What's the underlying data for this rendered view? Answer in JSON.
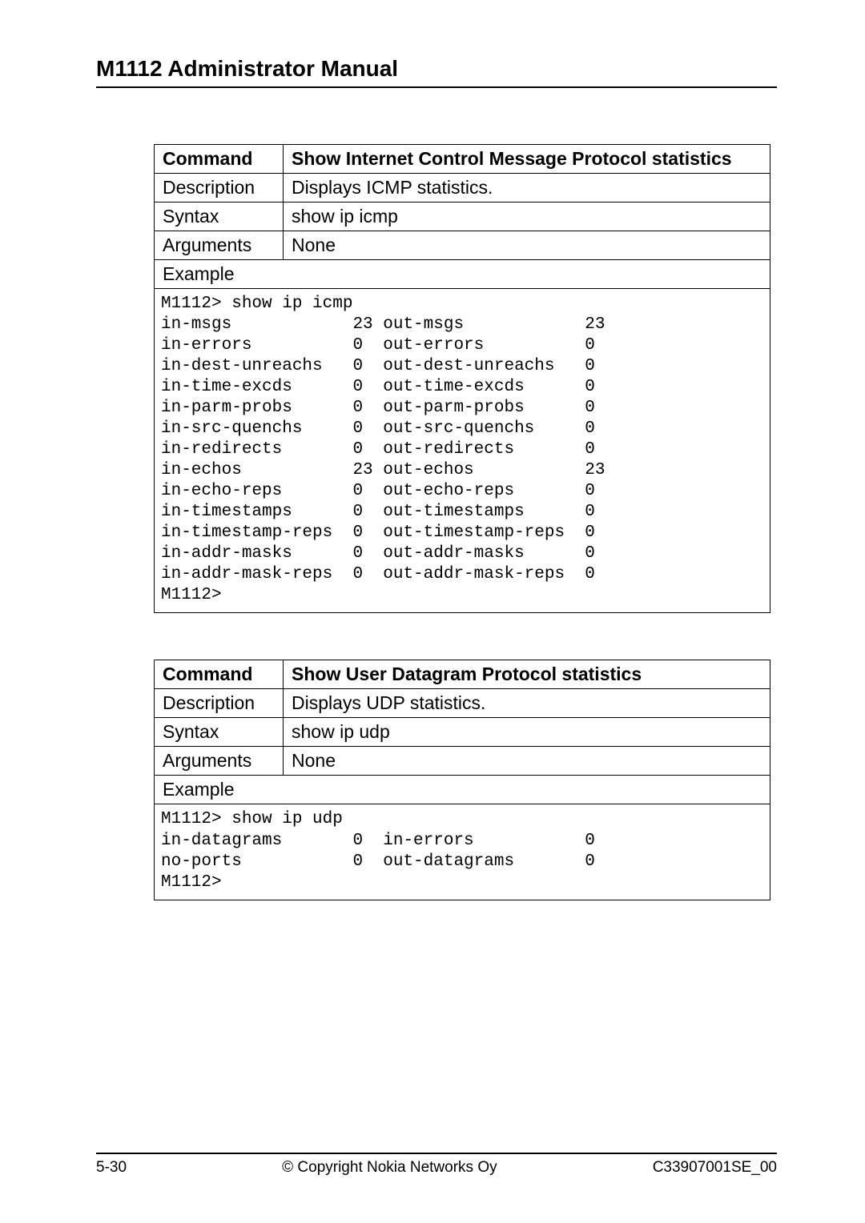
{
  "header": {
    "title": "M1112 Administrator Manual"
  },
  "table1": {
    "command_label": "Command",
    "command_value": "Show Internet Control Message Protocol statistics",
    "description_label": "Description",
    "description_value": "Displays ICMP statistics.",
    "syntax_label": "Syntax",
    "syntax_value": "show ip icmp",
    "arguments_label": "Arguments",
    "arguments_value": "None",
    "example_label": "Example",
    "example_code": "M1112> show ip icmp\nin-msgs            23 out-msgs            23\nin-errors          0  out-errors          0\nin-dest-unreachs   0  out-dest-unreachs   0\nin-time-excds      0  out-time-excds      0\nin-parm-probs      0  out-parm-probs      0\nin-src-quenchs     0  out-src-quenchs     0\nin-redirects       0  out-redirects       0\nin-echos           23 out-echos           23\nin-echo-reps       0  out-echo-reps       0\nin-timestamps      0  out-timestamps      0\nin-timestamp-reps  0  out-timestamp-reps  0\nin-addr-masks      0  out-addr-masks      0\nin-addr-mask-reps  0  out-addr-mask-reps  0\nM1112>"
  },
  "table2": {
    "command_label": "Command",
    "command_value": "Show User Datagram Protocol statistics",
    "description_label": "Description",
    "description_value": "Displays UDP statistics.",
    "syntax_label": "Syntax",
    "syntax_value": "show ip udp",
    "arguments_label": "Arguments",
    "arguments_value": "None",
    "example_label": "Example",
    "example_code": "M1112> show ip udp\nin-datagrams       0  in-errors           0\nno-ports           0  out-datagrams       0\nM1112>"
  },
  "footer": {
    "left": "5-30",
    "center": "© Copyright Nokia Networks Oy",
    "right": "C33907001SE_00"
  }
}
